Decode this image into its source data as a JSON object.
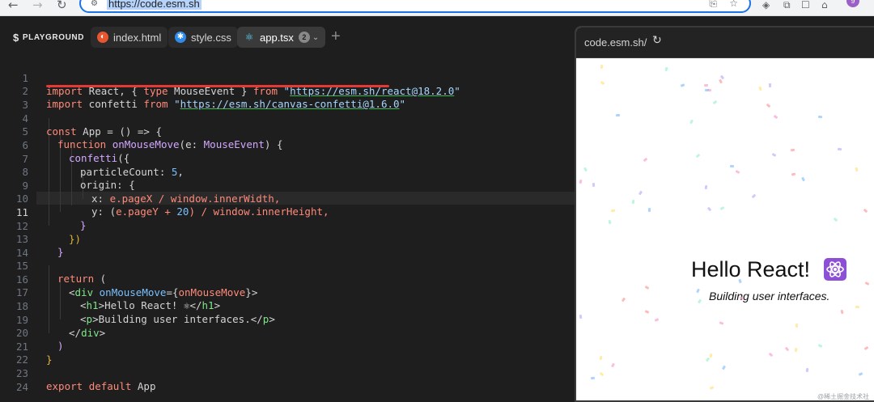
{
  "browser": {
    "url": "https://code.esm.sh",
    "avatar_letter": "9"
  },
  "playground": {
    "brand": "PLAYGROUND",
    "tabs": [
      {
        "label": "index.html"
      },
      {
        "label": "style.css"
      },
      {
        "label": "app.tsx",
        "badge": "2"
      }
    ]
  },
  "editor": {
    "current_line": "11",
    "line_numbers": [
      "1",
      "2",
      "3",
      "4",
      "5",
      "6",
      "7",
      "8",
      "9",
      "10",
      "11",
      "12",
      "13",
      "14",
      "15",
      "16",
      "17",
      "18",
      "19",
      "20",
      "21",
      "22",
      "23",
      "24"
    ]
  },
  "code": {
    "l1": {
      "kw1": "import",
      "t1": " React, { ",
      "kw2": "type",
      "t2": " MouseEvent } ",
      "kw3": "from",
      "sp": " ",
      "q1": "\"",
      "url": "https://esm.sh/react@18.2.0",
      "q2": "\""
    },
    "l2": {
      "kw1": "import",
      "t1": " confetti ",
      "kw2": "from",
      "sp": " ",
      "q1": "\"",
      "url": "https://esm.sh/canvas-confetti@1.6.0",
      "q2": "\""
    },
    "l4": {
      "kw1": "const",
      "t1": " App = () => {"
    },
    "l5": {
      "kw1": "function",
      "sp": " ",
      "fn": "onMouseMove",
      "t1": "(e: ",
      "type": "MouseEvent",
      "t2": ") {"
    },
    "l6": {
      "fn": "confetti",
      "t1": "({"
    },
    "l7": {
      "t1": "particleCount: ",
      "num": "5",
      "t2": ","
    },
    "l8": {
      "t1": "origin: {"
    },
    "l9": {
      "t1": "x: ",
      "e": "e",
      "t2": ".pageX / ",
      "w": "window",
      "t3": ".innerWidth,"
    },
    "l10": {
      "t1": "y: (",
      "e": "e",
      "t2": ".pageY + ",
      "num": "20",
      "t3": ") / ",
      "w": "window",
      "t4": ".innerHeight,"
    },
    "l11": {
      "t1": "}"
    },
    "l12": {
      "t1": "})"
    },
    "l13": {
      "t1": "}"
    },
    "l15": {
      "kw1": "return",
      "t1": " ("
    },
    "l16": {
      "t1": "<",
      "tag": "div",
      "sp": " ",
      "att": "onMouseMove",
      "t2": "={",
      "v": "onMouseMove",
      "t3": "}>"
    },
    "l17": {
      "t1": "<",
      "tag": "h1",
      "t2": ">Hello React! ⚛</",
      "tag2": "h1",
      "t3": ">"
    },
    "l18": {
      "t1": "<",
      "tag": "p",
      "t2": ">Building user interfaces.</",
      "tag2": "p",
      "t3": ">"
    },
    "l19": {
      "t1": "</",
      "tag": "div",
      "t2": ">"
    },
    "l20": {
      "t1": ")"
    },
    "l21": {
      "t1": "}"
    },
    "l23": {
      "kw1": "export",
      "sp": " ",
      "kw2": "default",
      "t1": " App"
    }
  },
  "preview": {
    "url": "code.esm.sh/",
    "heading": "Hello React!",
    "subtitle": "Building user interfaces."
  },
  "watermark": "@稀土掘金技术社区",
  "colors": {
    "accent": "#1a73e8",
    "highlight_underline": "#e53935",
    "editor_bg": "#1e1e1e",
    "atom_icon": "#8c4fd6"
  },
  "icons": [
    "back-arrow-icon",
    "forward-arrow-icon",
    "reload-icon",
    "site-settings-icon",
    "translate-icon",
    "bookmark-star-icon",
    "extension-icon",
    "html-file-icon",
    "css-file-icon",
    "react-file-icon",
    "chevron-down-icon",
    "plus-icon",
    "refresh-icon",
    "react-atom-icon"
  ]
}
